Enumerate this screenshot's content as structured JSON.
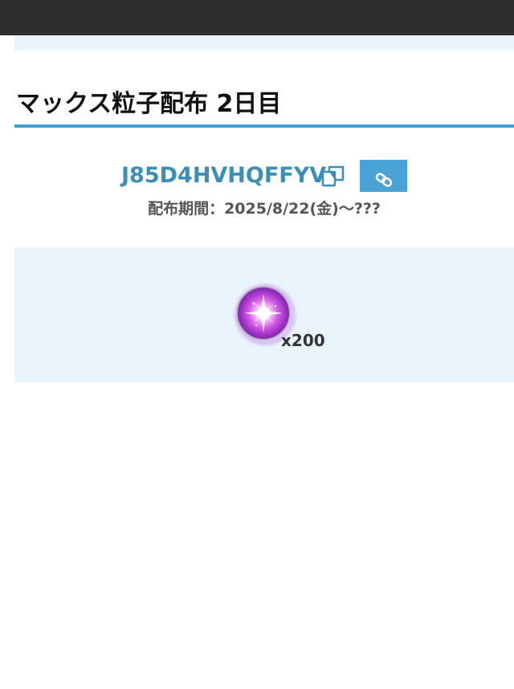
{
  "section": {
    "title": "マックス粒子配布 2日目"
  },
  "code": {
    "value": "J85D4HVHQFFYV",
    "copy_icon": "copy-icon",
    "link_icon": "link-icon"
  },
  "period": {
    "text": "配布期間：2025/8/22(金)〜???"
  },
  "reward": {
    "icon": "max-particle-icon",
    "quantity": "x200"
  },
  "colors": {
    "topbar": "#2e2e2e",
    "accent": "#3d9fd2",
    "code_text": "#3a8fb8",
    "button": "#4aa3d6",
    "panel": "#eaf4fc"
  }
}
